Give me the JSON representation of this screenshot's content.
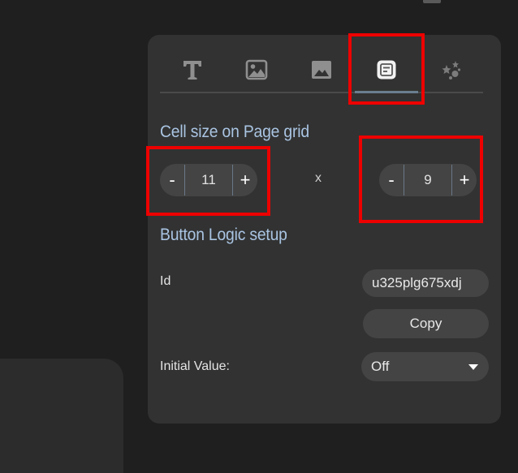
{
  "tabs": [
    {
      "icon": "text-icon",
      "active": false
    },
    {
      "icon": "image-icon",
      "active": false
    },
    {
      "icon": "picture-icon",
      "active": false
    },
    {
      "icon": "button-logic-icon",
      "active": true
    },
    {
      "icon": "effects-icon",
      "active": false
    }
  ],
  "cell_size": {
    "title": "Cell size on Page grid",
    "width": {
      "value": "11",
      "minus": "-",
      "plus": "+"
    },
    "separator": "x",
    "height": {
      "value": "9",
      "minus": "-",
      "plus": "+"
    }
  },
  "logic": {
    "title": "Button Logic setup",
    "id_label": "Id",
    "id_value": "u325plg675xdj",
    "copy_label": "Copy",
    "initial_label": "Initial Value:",
    "initial_value": "Off"
  },
  "colors": {
    "accent_title": "#a9c4e2",
    "highlight": "#ee0000",
    "panel": "#323232",
    "control": "#444444"
  }
}
